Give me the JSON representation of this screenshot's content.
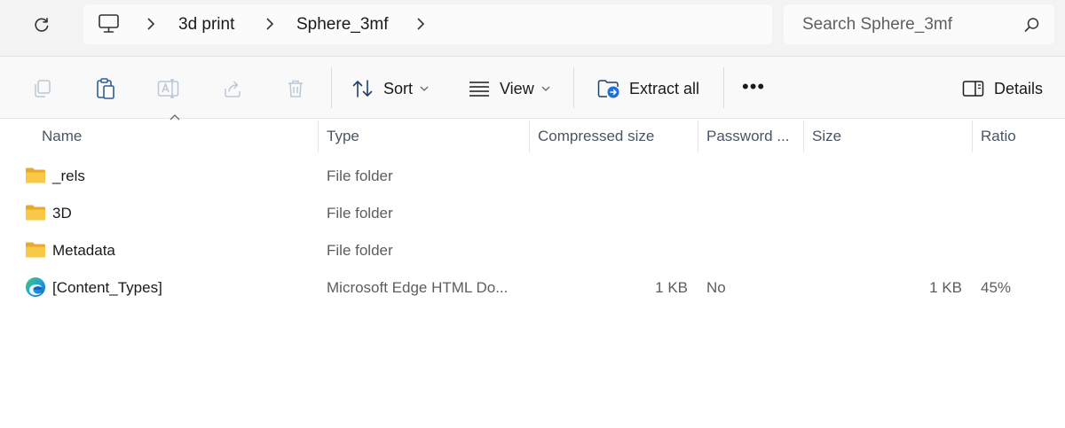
{
  "address_bar": {
    "breadcrumbs": [
      "3d print",
      "Sphere_3mf"
    ],
    "search_placeholder": "Search Sphere_3mf"
  },
  "toolbar": {
    "sort_label": "Sort",
    "view_label": "View",
    "extract_label": "Extract all",
    "more_label": "•••",
    "details_label": "Details"
  },
  "columns": [
    "Name",
    "Type",
    "Compressed size",
    "Password ...",
    "Size",
    "Ratio"
  ],
  "rows": [
    {
      "name": "_rels",
      "type": "File folder",
      "compressed": "",
      "password": "",
      "size": "",
      "ratio": "",
      "icon": "folder-icon"
    },
    {
      "name": "3D",
      "type": "File folder",
      "compressed": "",
      "password": "",
      "size": "",
      "ratio": "",
      "icon": "folder-icon"
    },
    {
      "name": "Metadata",
      "type": "File folder",
      "compressed": "",
      "password": "",
      "size": "",
      "ratio": "",
      "icon": "folder-icon"
    },
    {
      "name": "[Content_Types]",
      "type": "Microsoft Edge HTML Do...",
      "compressed": "1 KB",
      "password": "No",
      "size": "1 KB",
      "ratio": "45%",
      "icon": "edge-icon"
    }
  ],
  "colors": {
    "folder": "#f8c846",
    "folder_dark": "#e8a92c",
    "edge_blue": "#0c66c2",
    "edge_green": "#4fc466"
  }
}
